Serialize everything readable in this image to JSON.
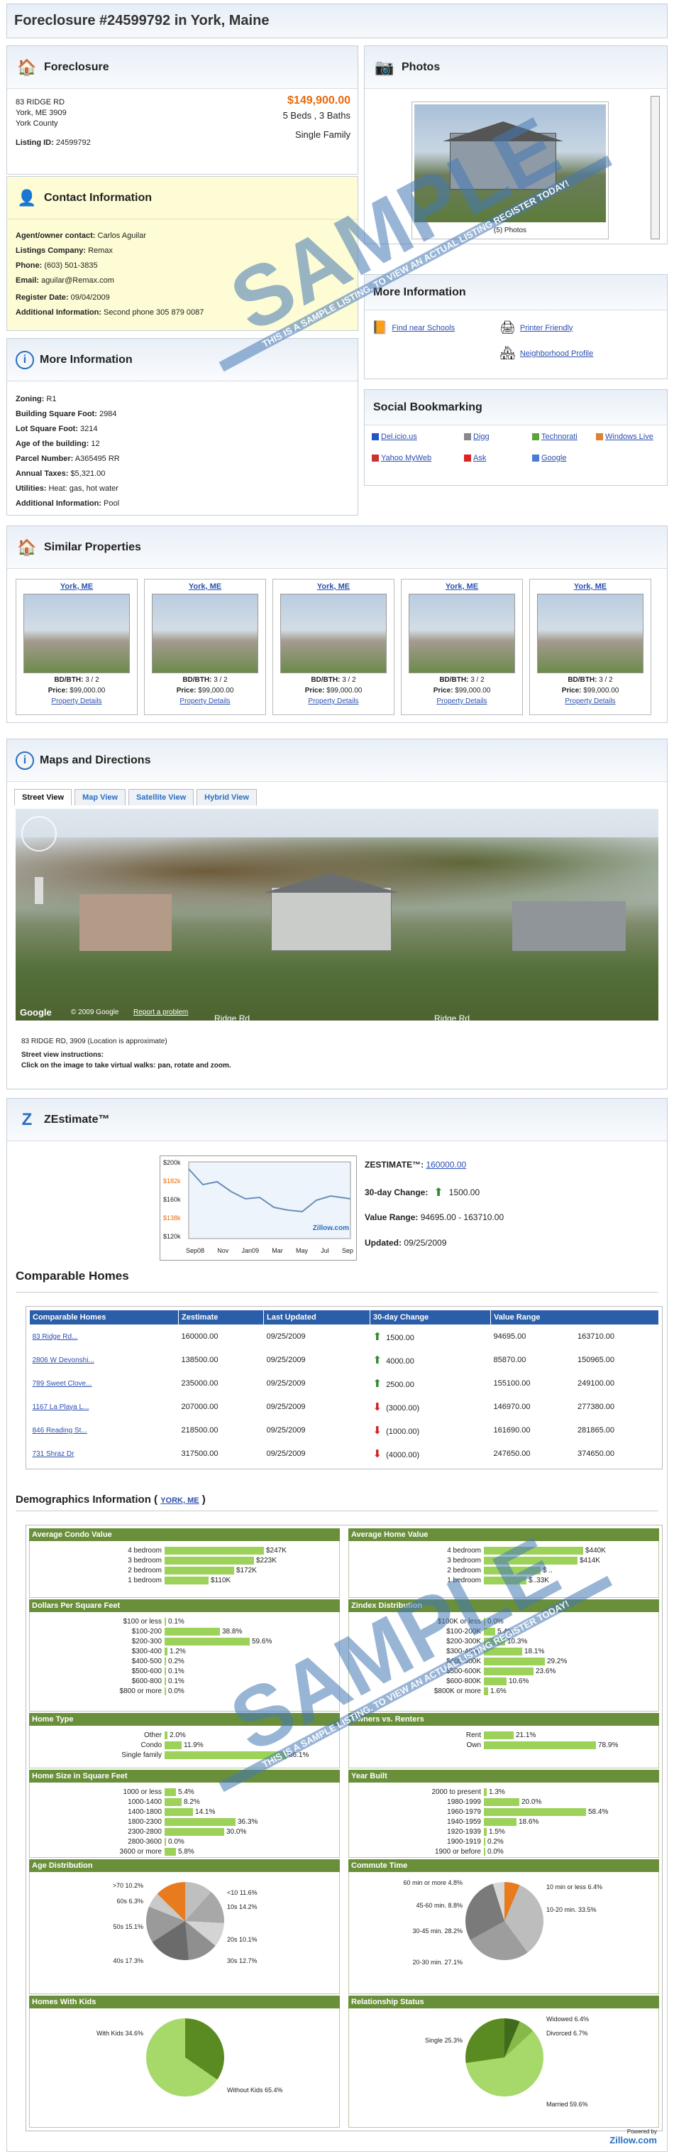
{
  "page_title": "Foreclosure #24599792 in York, Maine",
  "listing": {
    "heading": "Foreclosure",
    "addr1": "83 RIDGE RD",
    "addr2": "York, ME 3909",
    "county": "York County",
    "listing_id_label": "Listing ID:",
    "listing_id": "24599792",
    "price": "$149,900.00",
    "beds": "5 Beds , 3 Baths",
    "type": "Single Family"
  },
  "contact": {
    "heading": "Contact Information",
    "rows": [
      {
        "label": "Agent/owner contact:",
        "value": "Carlos Aguilar"
      },
      {
        "label": "Listings Company:",
        "value": "Remax"
      },
      {
        "label": "Phone:",
        "value": "(603) 501-3835"
      },
      {
        "label": "Email:",
        "value": "aguilar@Remax.com"
      },
      {
        "label": "Register Date:",
        "value": "09/04/2009"
      },
      {
        "label": "Additional Information:",
        "value": "Second phone 305 879 0087"
      }
    ]
  },
  "more": {
    "heading": "More Information",
    "rows": [
      {
        "label": "Zoning:",
        "value": "R1"
      },
      {
        "label": "Building Square Foot:",
        "value": "2984"
      },
      {
        "label": "Lot Square Foot:",
        "value": "3214"
      },
      {
        "label": "Age of the building:",
        "value": "12"
      },
      {
        "label": "Parcel Number:",
        "value": "A365495 RR"
      },
      {
        "label": "Annual Taxes:",
        "value": "$5,321.00"
      },
      {
        "label": "Utilities:",
        "value": "Heat: gas, hot water"
      },
      {
        "label": "Additional Information:",
        "value": "Pool"
      }
    ]
  },
  "photos": {
    "heading": "Photos",
    "caption": "(5) Photos"
  },
  "moreinfo": {
    "heading": "More Information",
    "schools": "Find near Schools",
    "printer": "Printer Friendly",
    "neighborhood": "Neighborhood Profile"
  },
  "social": {
    "heading": "Social Bookmarking",
    "items": [
      "Del.icio.us",
      "Digg",
      "Technorati",
      "Windows Live",
      "Yahoo MyWeb",
      "Ask",
      "Google"
    ]
  },
  "similar": {
    "heading": "Similar Properties",
    "items": [
      {
        "city": "York, ME",
        "bdbth_label": "BD/BTH:",
        "bdbth": "3 / 2",
        "price_label": "Price:",
        "price": "$99,000.00",
        "link": "Property Details"
      },
      {
        "city": "York, ME",
        "bdbth_label": "BD/BTH:",
        "bdbth": "3 / 2",
        "price_label": "Price:",
        "price": "$99,000.00",
        "link": "Property Details"
      },
      {
        "city": "York, ME",
        "bdbth_label": "BD/BTH:",
        "bdbth": "3 / 2",
        "price_label": "Price:",
        "price": "$99,000.00",
        "link": "Property Details"
      },
      {
        "city": "York, ME",
        "bdbth_label": "BD/BTH:",
        "bdbth": "3 / 2",
        "price_label": "Price:",
        "price": "$99,000.00",
        "link": "Property Details"
      },
      {
        "city": "York, ME",
        "bdbth_label": "BD/BTH:",
        "bdbth": "3 / 2",
        "price_label": "Price:",
        "price": "$99,000.00",
        "link": "Property Details"
      }
    ]
  },
  "maps": {
    "heading": "Maps and Directions",
    "tabs": [
      "Street View",
      "Map View",
      "Satellite View",
      "Hybrid View"
    ],
    "google": "Google",
    "copyright": "© 2009 Google",
    "report": "Report a problem",
    "road1": "Ridge Rd",
    "road2": "Ridge Rd",
    "addr_note": "83 RIDGE RD, 3909 (Location is approximate)",
    "instr1": "Street view instructions:",
    "instr2": "Click on the image to take virtual walks: pan, rotate and zoom."
  },
  "zestimate": {
    "heading": "ZEstimate™",
    "zest_label": "ZESTIMATE™:",
    "zest_value": "160000.00",
    "change_label": "30-day Change:",
    "change_value": "1500.00",
    "range_label": "Value Range:",
    "range_value": "94695.00 - 163710.00",
    "updated_label": "Updated:",
    "updated_value": "09/25/2009",
    "chart_y": [
      "$200k",
      "$182k",
      "$160k",
      "$138k",
      "$120k"
    ],
    "chart_x": [
      "Sep08",
      "Nov",
      "Jan09",
      "Mar",
      "May",
      "Jul",
      "Sep"
    ],
    "zillow": "Zillow.com"
  },
  "comparable": {
    "heading": "Comparable Homes",
    "headers": [
      "Comparable Homes",
      "Zestimate",
      "Last Updated",
      "30-day Change",
      "Value Range"
    ],
    "rows": [
      {
        "name": "83 Ridge Rd...",
        "z": "160000.00",
        "d": "09/25/2009",
        "c": "1500.00",
        "up": true,
        "lo": "94695.00",
        "hi": "163710.00"
      },
      {
        "name": "2806 W Devonshi...",
        "z": "138500.00",
        "d": "09/25/2009",
        "c": "4000.00",
        "up": true,
        "lo": "85870.00",
        "hi": "150965.00"
      },
      {
        "name": "789 Sweet Clove...",
        "z": "235000.00",
        "d": "09/25/2009",
        "c": "2500.00",
        "up": true,
        "lo": "155100.00",
        "hi": "249100.00"
      },
      {
        "name": "1167 La Playa L...",
        "z": "207000.00",
        "d": "09/25/2009",
        "c": "(3000.00)",
        "up": false,
        "lo": "146970.00",
        "hi": "277380.00"
      },
      {
        "name": "846 Reading St...",
        "z": "218500.00",
        "d": "09/25/2009",
        "c": "(1000.00)",
        "up": false,
        "lo": "161690.00",
        "hi": "281865.00"
      },
      {
        "name": "731 Shraz Dr",
        "z": "317500.00",
        "d": "09/25/2009",
        "c": "(4000.00)",
        "up": false,
        "lo": "247650.00",
        "hi": "374650.00"
      }
    ]
  },
  "demo": {
    "heading": "Demographics Information (",
    "link": "YORK, ME",
    "close": ")",
    "condo": {
      "title": "Average Condo Value",
      "rows": [
        [
          "4 bedroom",
          "$247K",
          0.7
        ],
        [
          "3 bedroom",
          "$223K",
          0.63
        ],
        [
          "2 bedroom",
          "$172K",
          0.49
        ],
        [
          "1 bedroom",
          "$110K",
          0.31
        ]
      ]
    },
    "home": {
      "title": "Average Home Value",
      "rows": [
        [
          "4 bedroom",
          "$440K",
          0.7
        ],
        [
          "3 bedroom",
          "$414K",
          0.66
        ],
        [
          "2 bedroom",
          "$ ..",
          0.4
        ],
        [
          "1 bedroom",
          "$..33K",
          0.3
        ]
      ]
    },
    "dpsf": {
      "title": "Dollars Per Square Feet",
      "rows": [
        [
          "$100 or less",
          "0.1%",
          0.01
        ],
        [
          "$100-200",
          "38.8%",
          0.39
        ],
        [
          "$200-300",
          "59.6%",
          0.6
        ],
        [
          "$300-400",
          "1.2%",
          0.02
        ],
        [
          "$400-500",
          "0.2%",
          0.01
        ],
        [
          "$500-600",
          "0.1%",
          0.01
        ],
        [
          "$600-800",
          "0.1%",
          0.01
        ],
        [
          "$800 or more",
          "0.0%",
          0
        ]
      ]
    },
    "zindex": {
      "title": "Zindex Distribution",
      "rows": [
        [
          "$100K or less",
          "0.0%",
          0
        ],
        [
          "$100-200K",
          "5.4%",
          0.08
        ],
        [
          "$200-300K",
          "10.3%",
          0.15
        ],
        [
          "$300-400K",
          "18.1%",
          0.27
        ],
        [
          "$400-500K",
          "29.2%",
          0.43
        ],
        [
          "$500-600K",
          "23.6%",
          0.35
        ],
        [
          "$600-800K",
          "10.6%",
          0.16
        ],
        [
          "$800K or more",
          "1.6%",
          0.03
        ]
      ]
    },
    "hometype": {
      "title": "Home Type",
      "rows": [
        [
          "Other",
          "2.0%",
          0.02
        ],
        [
          "Condo",
          "11.9%",
          0.12
        ],
        [
          "Single family",
          "86.1%",
          0.86
        ]
      ]
    },
    "owners": {
      "title": "Owners vs. Renters",
      "rows": [
        [
          "Rent",
          "21.1%",
          0.21
        ],
        [
          "Own",
          "78.9%",
          0.79
        ]
      ]
    },
    "size": {
      "title": "Home Size in Square Feet",
      "rows": [
        [
          "1000 or less",
          "5.4%",
          0.08
        ],
        [
          "1000-1400",
          "8.2%",
          0.12
        ],
        [
          "1400-1800",
          "14.1%",
          0.2
        ],
        [
          "1800-2300",
          "36.3%",
          0.5
        ],
        [
          "2300-2800",
          "30.0%",
          0.42
        ],
        [
          "2800-3600",
          "0.0%",
          0
        ],
        [
          "3600 or more",
          "5.8%",
          0.08
        ]
      ]
    },
    "year": {
      "title": "Year Built",
      "rows": [
        [
          "2000 to present",
          "1.3%",
          0.02
        ],
        [
          "1980-1999",
          "20.0%",
          0.25
        ],
        [
          "1960-1979",
          "58.4%",
          0.72
        ],
        [
          "1940-1959",
          "18.6%",
          0.23
        ],
        [
          "1920-1939",
          "1.5%",
          0.02
        ],
        [
          "1900-1919",
          "0.2%",
          0.01
        ],
        [
          "1900 or before",
          "0.0%",
          0
        ]
      ]
    },
    "age": {
      "title": "Age Distribution",
      "labels": [
        ">70 10.2%",
        "60s 6.3%",
        "50s 15.1%",
        "40s 17.3%",
        "<10 11.6%",
        "10s 14.2%",
        "20s 10.1%",
        "30s 12.7%"
      ]
    },
    "commute": {
      "title": "Commute Time",
      "labels": [
        "60 min or more 4.8%",
        "45-60 min. 8.8%",
        "30-45 min. 28.2%",
        "20-30 min. 27.1%",
        "10 min or less 6.4%",
        "10-20 min. 33.5%"
      ]
    },
    "kids": {
      "title": "Homes With Kids",
      "labels": [
        "With Kids 34.6%",
        "Without Kids 65.4%"
      ]
    },
    "rel": {
      "title": "Relationship Status",
      "labels": [
        "Widowed 6.4%",
        "Divorced 6.7%",
        "Single 25.3%",
        "Married 59.6%"
      ]
    },
    "powered": "Powered by",
    "zillow": "Zillow.com"
  },
  "watermark": {
    "big": "SAMPLE",
    "small": "THIS IS A SAMPLE LISTING. TO VIEW AN ACTUAL LISTING REGISTER TODAY!"
  }
}
